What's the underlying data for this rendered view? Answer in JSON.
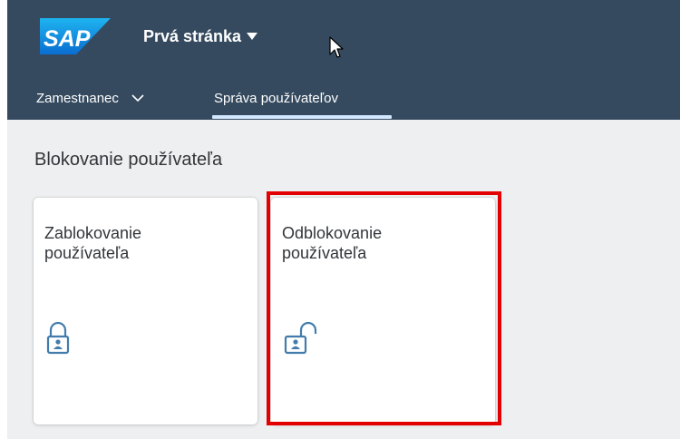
{
  "header": {
    "logo_text": "SAP",
    "title": "Prvá stránka"
  },
  "nav": {
    "items": [
      {
        "label": "Zamestnanec"
      },
      {
        "label": "Správa používateľov"
      }
    ]
  },
  "section": {
    "title": "Blokovanie používateľa"
  },
  "tiles": [
    {
      "line1": "Zablokovanie",
      "line2": "používateľa",
      "icon": "locked-icon"
    },
    {
      "line1": "Odblokovanie",
      "line2": "používateľa",
      "icon": "unlocked-icon"
    }
  ],
  "colors": {
    "shell": "#354a5f",
    "background": "#edeff0",
    "icon": "#427cac",
    "highlight": "#e30000"
  }
}
